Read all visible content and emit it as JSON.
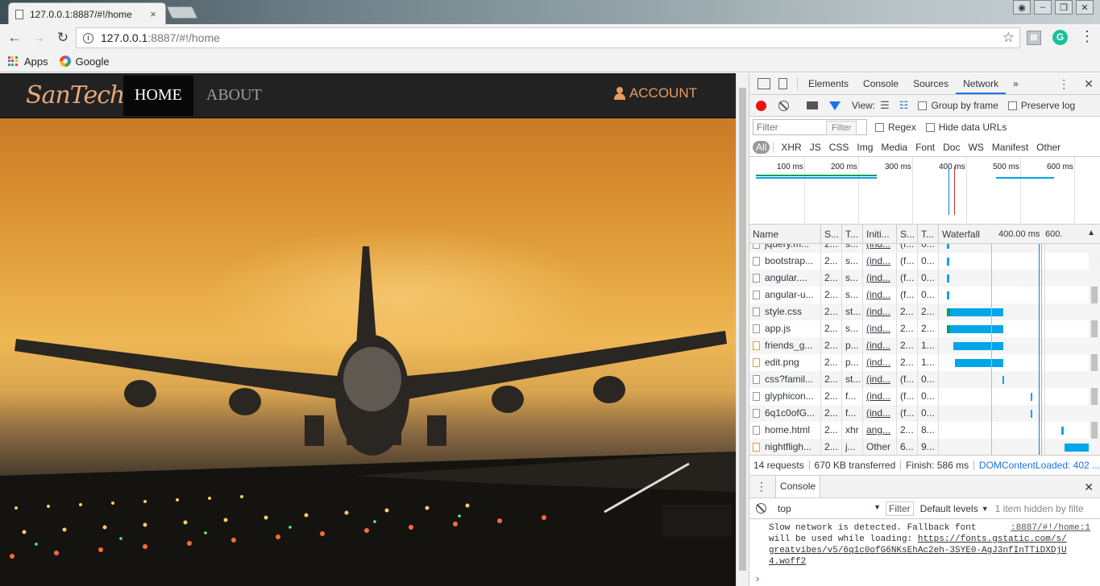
{
  "browser": {
    "tab_title": "127.0.0.1:8887/#!/home",
    "tab_close": "×",
    "url_host": "127.0.0.1",
    "url_rest": ":8887/#!/home",
    "bookmarks": [
      {
        "label": "Apps",
        "icon": "apps-grid-icon"
      },
      {
        "label": "Google",
        "icon": "google-icon"
      }
    ],
    "icons": {
      "back": "arrow-left-icon",
      "forward": "arrow-right-icon",
      "reload": "reload-icon",
      "star": "star-icon",
      "menu": "vertical-dots-icon"
    }
  },
  "site": {
    "brand": "SanTech",
    "nav": [
      {
        "label": "HOME",
        "active": true
      },
      {
        "label": "ABOUT",
        "active": false
      }
    ],
    "account": "ACCOUNT",
    "accent": "#e89b5e",
    "navbar_bg": "#222222"
  },
  "devtools": {
    "tabs": [
      "Elements",
      "Console",
      "Sources",
      "Network"
    ],
    "active_tab": "Network",
    "more": "»",
    "toolbar": {
      "view_label": "View:",
      "group_by_frame": "Group by frame",
      "preserve_log": "Preserve log"
    },
    "filter": {
      "placeholder": "Filter",
      "tooltip": "Filter",
      "regex": "Regex",
      "hide_data_urls": "Hide data URLs"
    },
    "types": [
      "All",
      "XHR",
      "JS",
      "CSS",
      "Img",
      "Media",
      "Font",
      "Doc",
      "WS",
      "Manifest",
      "Other"
    ],
    "overview_ticks": [
      "100 ms",
      "200 ms",
      "300 ms",
      "400 ms",
      "500 ms",
      "600 ms"
    ],
    "columns": [
      "Name",
      "S...",
      "T...",
      "Initi...",
      "S...",
      "T...",
      "Waterfall",
      "400.00 ms",
      "600."
    ],
    "requests": [
      {
        "name": "jquery.m...",
        "status": "2...",
        "type": "s...",
        "initiator": "(ind...",
        "size": "(f...",
        "time": "0...",
        "icon": "script"
      },
      {
        "name": "bootstrap...",
        "status": "2...",
        "type": "s...",
        "initiator": "(ind...",
        "size": "(f...",
        "time": "0...",
        "icon": "script"
      },
      {
        "name": "angular....",
        "status": "2...",
        "type": "s...",
        "initiator": "(ind...",
        "size": "(f...",
        "time": "0...",
        "icon": "script"
      },
      {
        "name": "angular-u...",
        "status": "2...",
        "type": "s...",
        "initiator": "(ind...",
        "size": "(f...",
        "time": "0...",
        "icon": "script"
      },
      {
        "name": "style.css",
        "status": "2...",
        "type": "st...",
        "initiator": "(ind...",
        "size": "2...",
        "time": "2...",
        "icon": "stylesheet"
      },
      {
        "name": "app.js",
        "status": "2...",
        "type": "s...",
        "initiator": "(ind...",
        "size": "2...",
        "time": "2...",
        "icon": "script"
      },
      {
        "name": "friends_g...",
        "status": "2...",
        "type": "p...",
        "initiator": "(ind...",
        "size": "2...",
        "time": "1...",
        "icon": "image"
      },
      {
        "name": "edit.png",
        "status": "2...",
        "type": "p...",
        "initiator": "(ind...",
        "size": "2...",
        "time": "1...",
        "icon": "image"
      },
      {
        "name": "css?famil...",
        "status": "2...",
        "type": "st...",
        "initiator": "(ind...",
        "size": "(f...",
        "time": "0...",
        "icon": "stylesheet"
      },
      {
        "name": "glyphicon...",
        "status": "2...",
        "type": "f...",
        "initiator": "(ind...",
        "size": "(f...",
        "time": "0...",
        "icon": "font"
      },
      {
        "name": "6q1c0ofG...",
        "status": "2...",
        "type": "f...",
        "initiator": "(ind...",
        "size": "(f...",
        "time": "0...",
        "icon": "font"
      },
      {
        "name": "home.html",
        "status": "2...",
        "type": "xhr",
        "initiator": "ang...",
        "size": "2...",
        "time": "8...",
        "icon": "document"
      },
      {
        "name": "nightfligh...",
        "status": "2...",
        "type": "j...",
        "initiator": "Other",
        "size": "6...",
        "time": "9...",
        "icon": "image"
      }
    ],
    "summary": {
      "requests": "14 requests",
      "transferred": "670 KB transferred",
      "finish": "Finish: 586 ms",
      "dcl": "DOMContentLoaded: 402 ..."
    },
    "console": {
      "drawer_tab": "Console",
      "context": "top",
      "filter": "Filter",
      "levels": "Default levels",
      "hidden": "1 item hidden by filte",
      "message_line1": "Slow network is detected. Fallback font",
      "message_line2": "will be used while loading:",
      "message_link": "https://fonts.gstatic.com/s/greatvibes/v5/6q1c0ofG6NKsEhAc2eh-3SYE0-AgJ3nfInTTiDXDjU4.woff2",
      "message_source": ":8887/#!/home:1",
      "prompt": "›"
    }
  }
}
